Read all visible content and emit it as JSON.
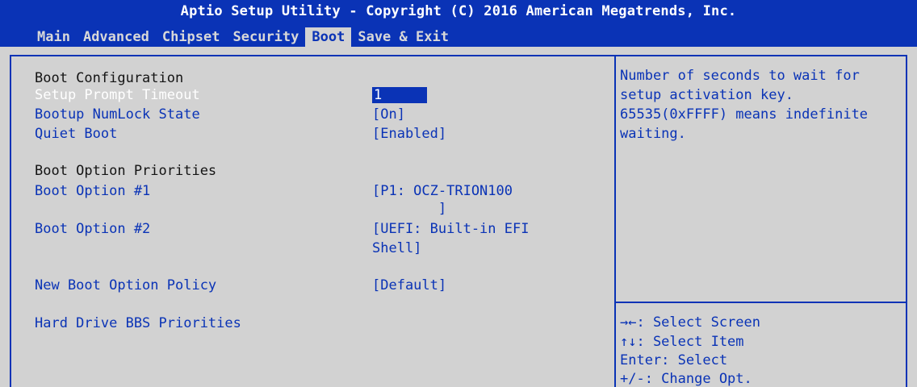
{
  "header": {
    "title": "Aptio Setup Utility - Copyright (C) 2016 American Megatrends, Inc."
  },
  "menu": {
    "items": [
      "Main",
      "Advanced",
      "Chipset",
      "Security",
      "Boot",
      "Save & Exit"
    ],
    "active": "Boot"
  },
  "boot": {
    "section_config": "Boot Configuration",
    "setup_prompt_timeout": {
      "label": "Setup Prompt Timeout",
      "value": "1"
    },
    "bootup_numlock_state": {
      "label": "Bootup NumLock State",
      "value": "[On]"
    },
    "quiet_boot": {
      "label": "Quiet Boot",
      "value": "[Enabled]"
    },
    "section_priorities": "Boot Option Priorities",
    "boot_option_1": {
      "label": "Boot Option #1",
      "value_line1": "[P1: OCZ-TRION100",
      "value_line2": "        ]"
    },
    "boot_option_2": {
      "label": "Boot Option #2",
      "value_line1": "[UEFI: Built-in EFI",
      "value_line2": "Shell]"
    },
    "new_boot_option_policy": {
      "label": "New Boot Option Policy",
      "value": "[Default]"
    },
    "hard_drive_bbs_priorities": {
      "label": "Hard Drive BBS Priorities"
    }
  },
  "help": {
    "lines": [
      "Number of seconds to wait for",
      "setup activation key.",
      "65535(0xFFFF) means indefinite",
      "waiting."
    ]
  },
  "keys": {
    "lines": [
      "→←: Select Screen",
      "↑↓: Select Item",
      "Enter: Select",
      "+/-: Change Opt."
    ]
  },
  "colors": {
    "bios_blue": "#0a33b6",
    "background_gray": "#d2d2d2",
    "header_text": "#141414",
    "white": "#ffffff"
  }
}
